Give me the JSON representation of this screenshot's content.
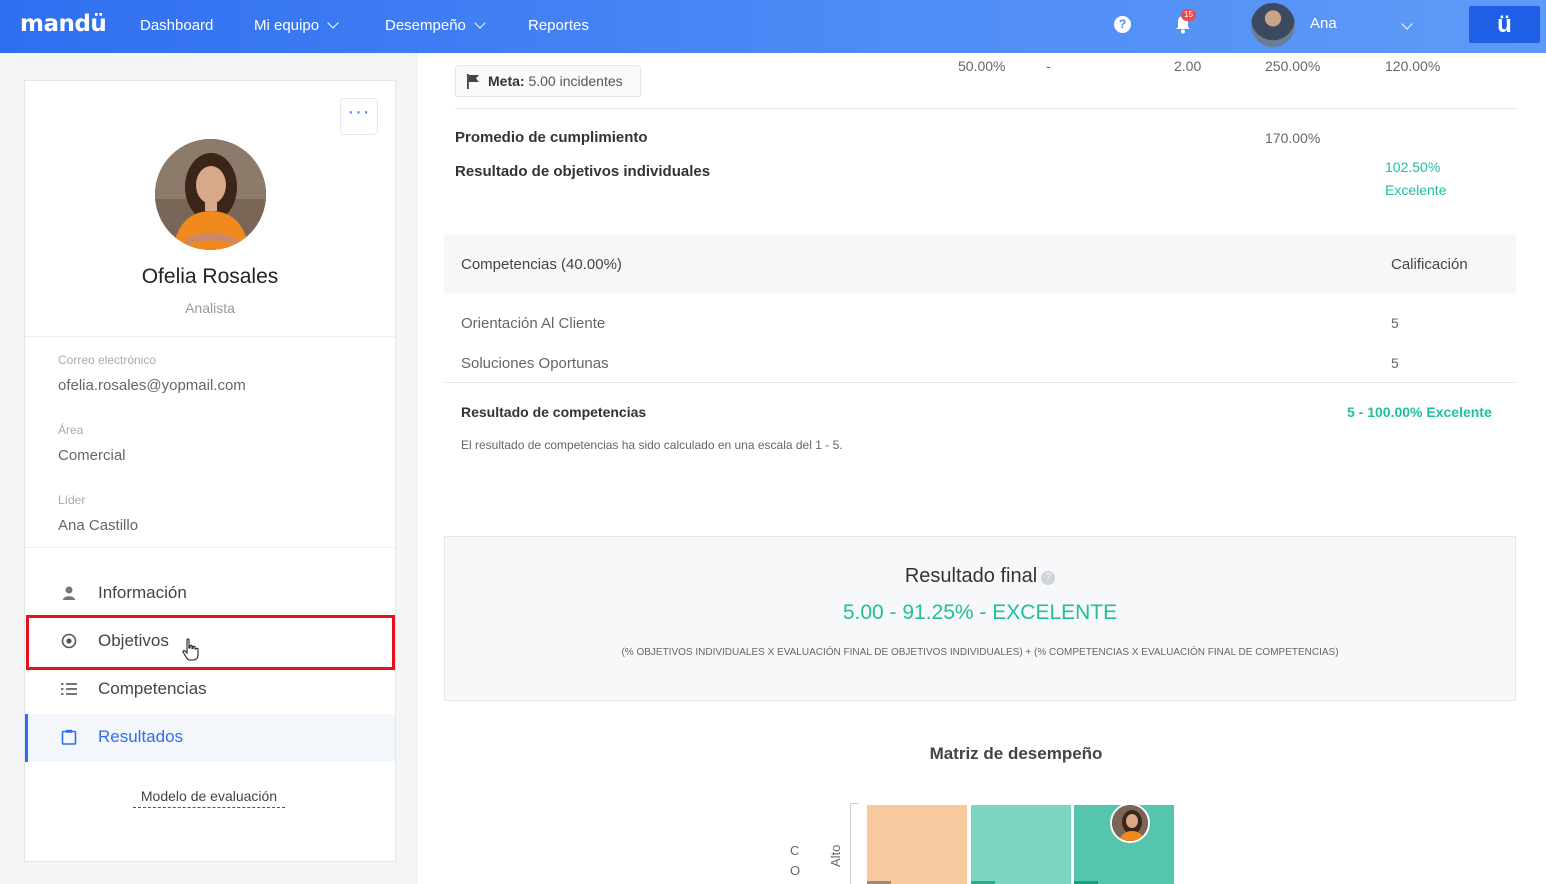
{
  "nav": {
    "logo": "mandü",
    "items": [
      {
        "label": "Dashboard"
      },
      {
        "label": "Mi equipo"
      },
      {
        "label": "Desempeño"
      },
      {
        "label": "Reportes"
      }
    ],
    "help_glyph": "?",
    "notifications_count": "15",
    "user_name": "Ana",
    "brand_button": "ü"
  },
  "profile": {
    "more_glyph": "···",
    "name": "Ofelia Rosales",
    "role": "Analista",
    "email_label": "Correo electrónico",
    "email": "ofelia.rosales@yopmail.com",
    "area_label": "Área",
    "area": "Comercial",
    "leader_label": "Líder",
    "leader": "Ana Castillo",
    "menu": [
      {
        "label": "Información",
        "icon": "user-icon"
      },
      {
        "label": "Objetivos",
        "icon": "target-icon"
      },
      {
        "label": "Competencias",
        "icon": "list-icon"
      },
      {
        "label": "Resultados",
        "icon": "clipboard-icon"
      }
    ],
    "model_link": "Modelo de evaluación"
  },
  "objectives": {
    "meta_label": "Meta:",
    "meta_value": "5.00 incidentes",
    "row_values": [
      "50.00%",
      "-",
      "2.00",
      "250.00%",
      "120.00%"
    ],
    "avg_label": "Promedio de cumplimiento",
    "avg_value": "170.00%",
    "result_label": "Resultado de objetivos individuales",
    "result_pct": "102.50%",
    "result_word": "Excelente"
  },
  "competencies": {
    "header": "Competencias (40.00%)",
    "header_right": "Calificación",
    "rows": [
      {
        "name": "Orientación Al Cliente",
        "score": "5"
      },
      {
        "name": "Soluciones Oportunas",
        "score": "5"
      }
    ],
    "result_label": "Resultado de competencias",
    "result_value": "5 - 100.00% Excelente",
    "note": "El resultado de competencias ha sido calculado en una escala del 1 - 5."
  },
  "final": {
    "title": "Resultado final",
    "help_glyph": "?",
    "score": "5.00 - 91.25% - EXCELENTE",
    "formula": "(% OBJETIVOS INDIVIDUALES X EVALUACIÓN FINAL DE OBJETIVOS INDIVIDUALES) + (% COMPETENCIAS X EVALUACIÓN FINAL DE COMPETENCIAS)"
  },
  "matrix": {
    "title": "Matriz de desempeño",
    "axis_letters": [
      "C",
      "O"
    ],
    "row_label": "Alto",
    "colors": {
      "cell1": "#f8c99e",
      "cell2": "#7dd6c0",
      "cell3": "#55c6ad"
    }
  },
  "colors": {
    "primary": "#2f6ef0",
    "success": "#1fbf9f",
    "highlight": "#e8101a"
  }
}
